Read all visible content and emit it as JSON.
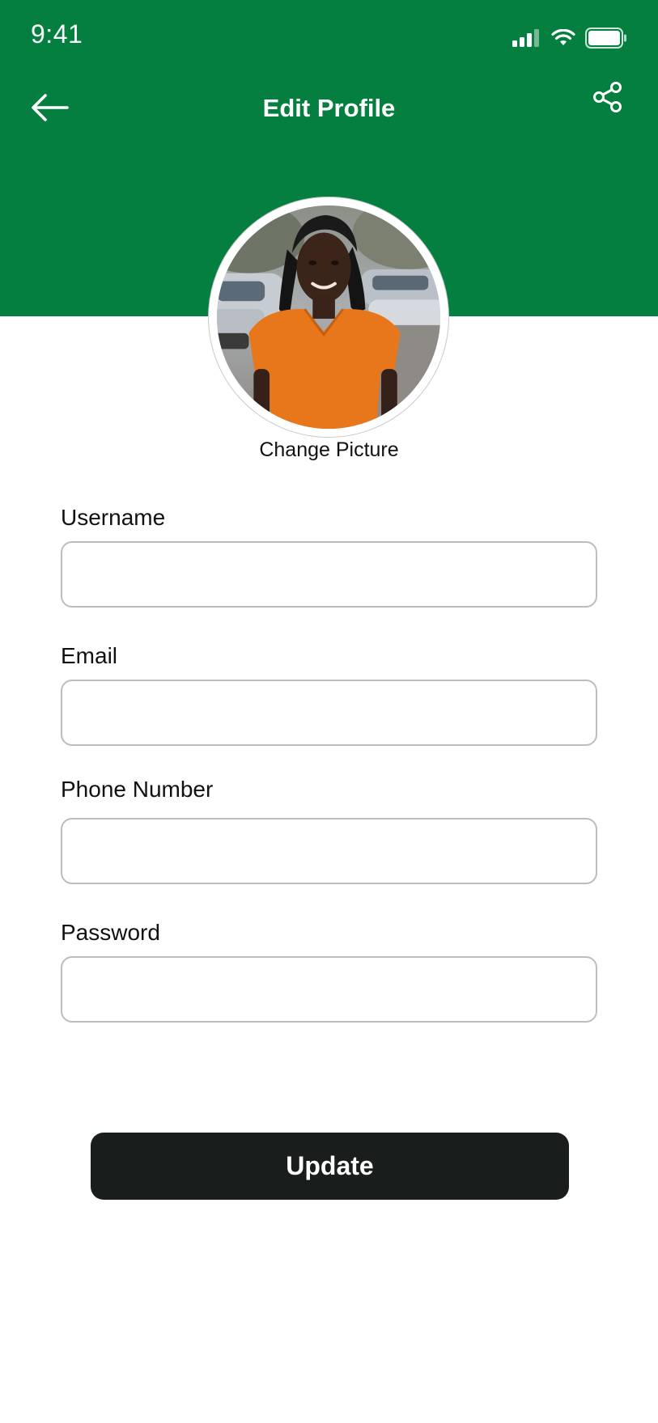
{
  "status_bar": {
    "time": "9:41"
  },
  "header": {
    "title": "Edit Profile",
    "back_icon": "arrow-left-icon",
    "share_icon": "share-icon",
    "background_color": "#047f3f"
  },
  "profile": {
    "change_picture_label": "Change Picture"
  },
  "form": {
    "username": {
      "label": "Username",
      "value": "",
      "placeholder": ""
    },
    "email": {
      "label": "Email",
      "value": "",
      "placeholder": ""
    },
    "phone": {
      "label": "Phone Number",
      "value": "",
      "placeholder": ""
    },
    "password": {
      "label": "Password",
      "value": "",
      "placeholder": ""
    }
  },
  "actions": {
    "update_label": "Update",
    "update_color": "#191e1c"
  }
}
